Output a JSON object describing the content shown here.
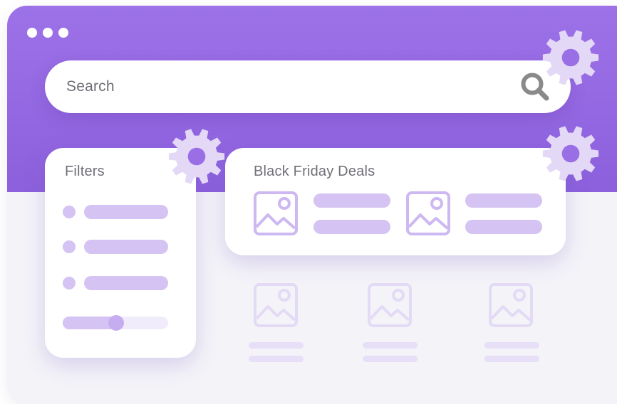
{
  "search": {
    "placeholder": "Search"
  },
  "filters": {
    "title": "Filters",
    "option_count": 3,
    "slider_value_percent": 51
  },
  "deals": {
    "title": "Black Friday Deals",
    "item_count": 2
  },
  "icons": {
    "search": "magnifier-icon",
    "settings": "gear-icon",
    "image": "image-placeholder-icon"
  },
  "colors": {
    "brand_purple": "#9a6fe6",
    "accent_lavender": "#d4c3f3",
    "icon_gray": "#8a8a8a",
    "gear": "#e3d8f6"
  }
}
